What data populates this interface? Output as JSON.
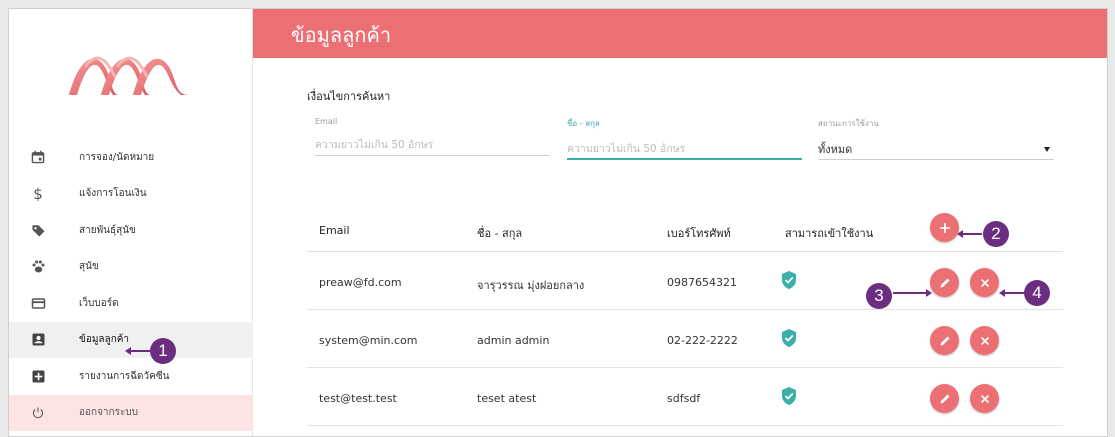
{
  "page": {
    "title": "ข้อมูลลูกค้า",
    "accent": "#ec6f74",
    "callout_color": "#6a2d80"
  },
  "sidebar": {
    "items": [
      {
        "label": "การจอง/นัดหมาย",
        "icon": "calendar-icon"
      },
      {
        "label": "แจ้งการโอนเงิน",
        "icon": "dollar-icon"
      },
      {
        "label": "สายพันธุ์สุนัข",
        "icon": "tag-icon"
      },
      {
        "label": "สุนัข",
        "icon": "paw-icon"
      },
      {
        "label": "เว็บบอร์ด",
        "icon": "card-icon"
      },
      {
        "label": "ข้อมูลลูกค้า",
        "icon": "account-box-icon"
      },
      {
        "label": "รายงานการฉีดวัคซีน",
        "icon": "plus-box-icon"
      },
      {
        "label": "ออกจากระบบ",
        "icon": "power-icon"
      }
    ]
  },
  "filter": {
    "title": "เงื่อนไขการค้นหา",
    "email": {
      "label": "Email",
      "placeholder": "ความยาวไม่เกิน 50 อักษร"
    },
    "name": {
      "label": "ชื่อ - สกุล",
      "placeholder": "ความยาวไม่เกิน 50 อักษร"
    },
    "status": {
      "label": "สถานะการใช้งาน",
      "value": "ทั้งหมด"
    }
  },
  "table": {
    "headers": {
      "email": "Email",
      "name": "ชื่อ - สกุล",
      "phone": "เบอร์โทรศัพท์",
      "access": "สามารถเข้าใช้งาน"
    },
    "rows": [
      {
        "email": "preaw@fd.com",
        "name": "จารุวรรณ มุ่งฝอยกลาง",
        "phone": "0987654321",
        "access": true
      },
      {
        "email": "system@min.com",
        "name": "admin admin",
        "phone": "02-222-2222",
        "access": true
      },
      {
        "email": "test@test.test",
        "name": "teset atest",
        "phone": "sdfsdf",
        "access": true
      }
    ]
  },
  "callouts": {
    "one": "1",
    "two": "2",
    "three": "3",
    "four": "4"
  }
}
